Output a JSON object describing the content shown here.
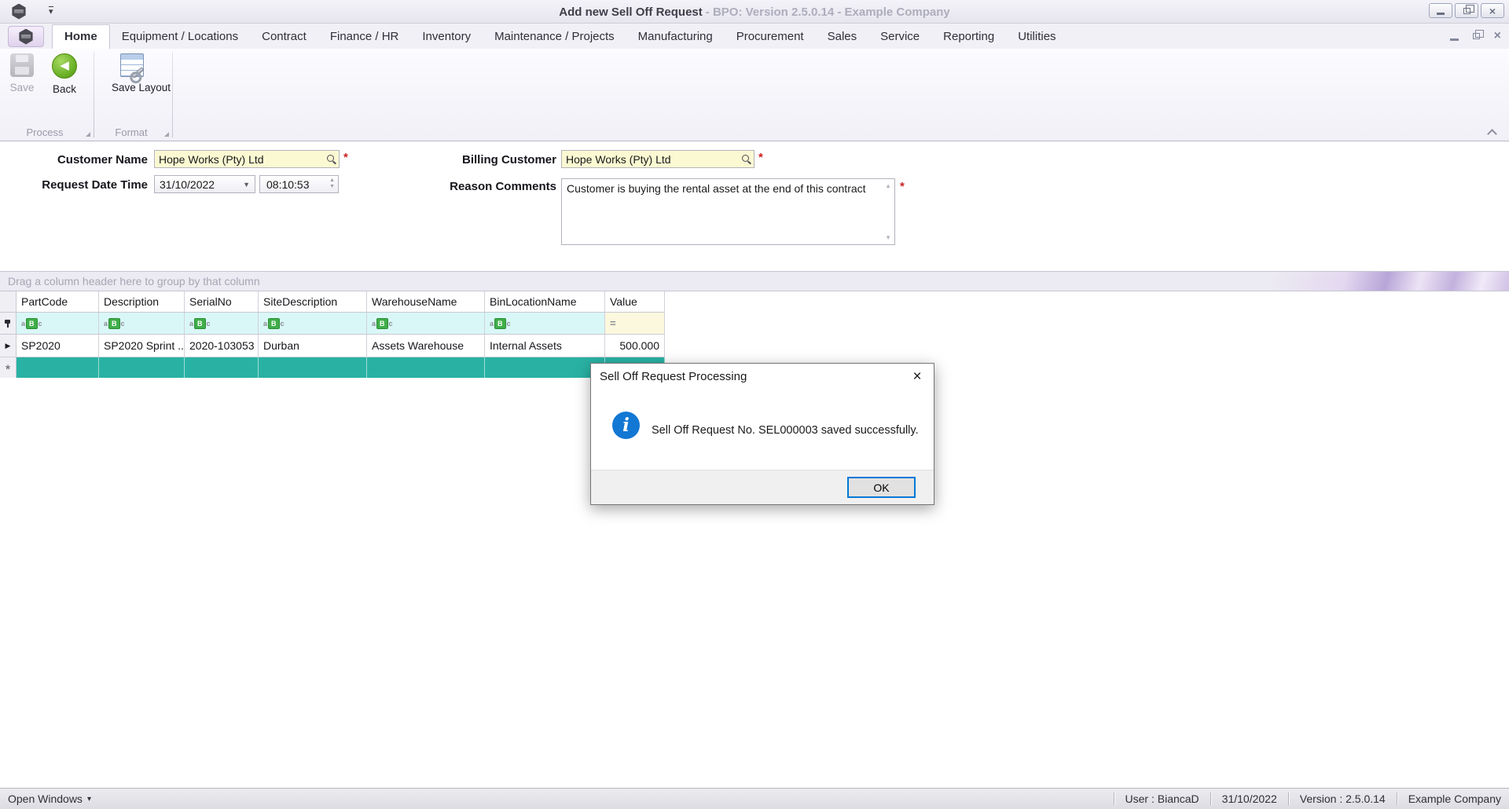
{
  "window": {
    "title_main": "Add new Sell Off Request",
    "title_rest": "- BPO: Version 2.5.0.14 - Example Company"
  },
  "ribbon": {
    "tabs": [
      {
        "label": "Home",
        "active": true
      },
      {
        "label": "Equipment / Locations",
        "active": false
      },
      {
        "label": "Contract",
        "active": false
      },
      {
        "label": "Finance / HR",
        "active": false
      },
      {
        "label": "Inventory",
        "active": false
      },
      {
        "label": "Maintenance / Projects",
        "active": false
      },
      {
        "label": "Manufacturing",
        "active": false
      },
      {
        "label": "Procurement",
        "active": false
      },
      {
        "label": "Sales",
        "active": false
      },
      {
        "label": "Service",
        "active": false
      },
      {
        "label": "Reporting",
        "active": false
      },
      {
        "label": "Utilities",
        "active": false
      }
    ],
    "buttons": {
      "save": "Save",
      "back": "Back",
      "save_layout": "Save Layout"
    },
    "groups": {
      "process": "Process",
      "format": "Format"
    }
  },
  "form": {
    "customer_name": {
      "label": "Customer Name",
      "value": "Hope Works (Pty) Ltd"
    },
    "billing_customer": {
      "label": "Billing Customer",
      "value": "Hope Works (Pty) Ltd"
    },
    "request_date_time": {
      "label": "Request Date  Time",
      "date": "31/10/2022",
      "time": "08:10:53"
    },
    "reason_comments": {
      "label": "Reason Comments",
      "value": "Customer is buying the rental asset at the end of this contract"
    },
    "required_marker": "*"
  },
  "grid": {
    "group_panel_text": "Drag a column header here to group by that column",
    "columns": [
      "PartCode",
      "Description",
      "SerialNo",
      "SiteDescription",
      "WarehouseName",
      "BinLocationName",
      "Value"
    ],
    "rows": [
      {
        "part_code": "SP2020",
        "description": "SP2020 Sprint ...",
        "serial_no": "2020-103053",
        "site_description": "Durban",
        "warehouse_name": "Assets Warehouse",
        "bin_location_name": "Internal Assets",
        "value": "500.000"
      }
    ]
  },
  "dialog": {
    "title": "Sell Off Request Processing",
    "message": "Sell Off Request No. SEL000003 saved successfully.",
    "ok_label": "OK"
  },
  "status_bar": {
    "left": "Open Windows",
    "right": [
      "User : BiancaD",
      "31/10/2022",
      "Version : 2.5.0.14",
      "Example Company"
    ]
  },
  "icons": {
    "info_i": "i",
    "close_x": "×",
    "mdi_close": "×",
    "caret_down_small": "▾",
    "combo_caret": "▼",
    "spin_up": "▲",
    "spin_down": "▼",
    "back_arrow": "◀",
    "row_arrow": "▶",
    "new_row_star": "*",
    "equals": "=",
    "abc_a": "a",
    "abc_b": "B",
    "abc_c": "c"
  },
  "colors": {
    "accent_teal": "#29b2a4",
    "filter_cyan": "#d9f7f7",
    "filter_yellow": "#fbf8de",
    "info_blue": "#1377d4",
    "focus_blue": "#0078d7",
    "required_red": "#cc2020",
    "back_green": "#6db32a",
    "input_yellow": "#fbf9d2"
  }
}
